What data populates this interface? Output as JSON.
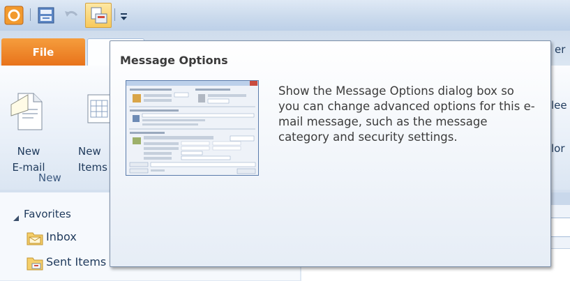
{
  "quick_access": {
    "icons": [
      "outlook-app-icon",
      "send-receive-icon",
      "undo-icon",
      "message-options-icon",
      "customize-qat-icon"
    ]
  },
  "tabs": {
    "file_label": "File",
    "partial_right_label": "er"
  },
  "ribbon": {
    "new_email_label_line1": "New",
    "new_email_label_line2": "E-mail",
    "new_items_label_line1": "New",
    "new_items_label_line2": "Items",
    "group_new_label": "New",
    "partial_right_1": "lee",
    "partial_right_2": "lor"
  },
  "nav": {
    "favorites_header": "Favorites",
    "inbox_label": "Inbox",
    "sent_label": "Sent Items"
  },
  "tooltip": {
    "title": "Message Options",
    "description": "Show the Message Options dialog box so you can change advanced options for this e-mail message, such as the message category and security settings."
  },
  "colors": {
    "file_tab": "#e8731b",
    "ribbon_text": "#1e395b",
    "tooltip_border": "#7b8ea8"
  }
}
